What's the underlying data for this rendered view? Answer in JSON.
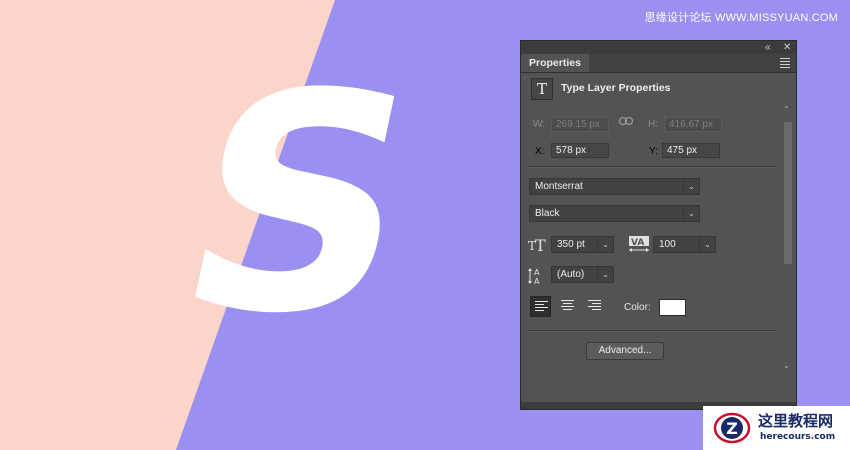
{
  "canvas": {
    "bg_left": "#fbd5c9",
    "bg_right": "#9a90f2",
    "letter": "S",
    "letter_color": "#ffffff"
  },
  "watermark_top": "思缘设计论坛 WWW.MISSYUAN.COM",
  "panel": {
    "tab": "Properties",
    "header_title": "Type Layer Properties",
    "header_icon": "T",
    "transform": {
      "w_label": "W:",
      "w_value": "269.15 px",
      "h_label": "H:",
      "h_value": "416.67 px",
      "x_label": "X:",
      "x_value": "578 px",
      "y_label": "Y:",
      "y_value": "475 px"
    },
    "font_family": "Montserrat",
    "font_style": "Black",
    "font_size": "350 pt",
    "tracking": "100",
    "leading": "(Auto)",
    "color_label": "Color:",
    "text_color": "#ffffff",
    "advanced_label": "Advanced..."
  },
  "logo": {
    "cn": "这里教程网",
    "en": "herecours.com",
    "mark": "Z"
  }
}
